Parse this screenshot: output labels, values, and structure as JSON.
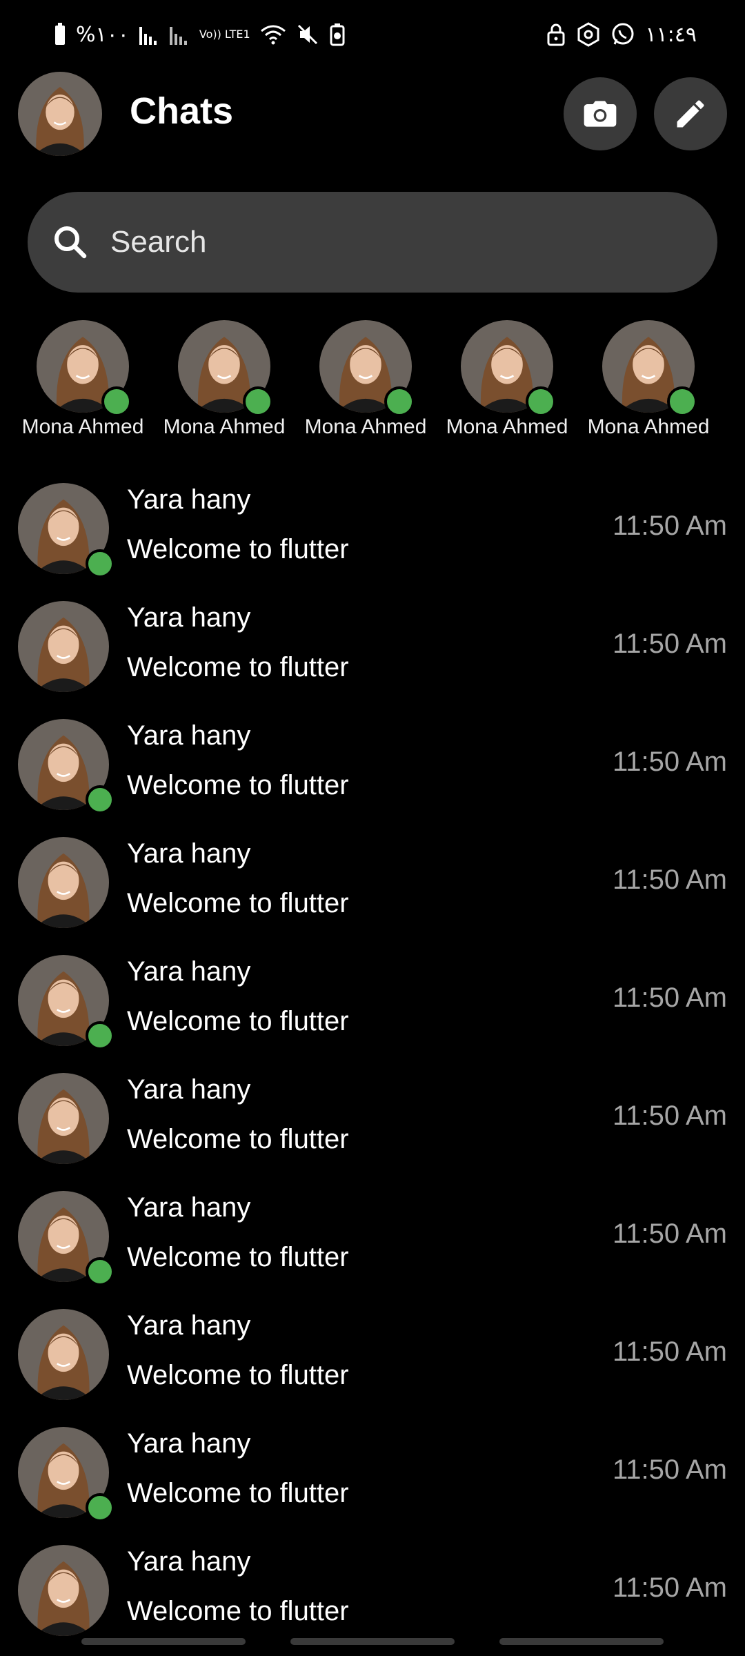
{
  "status_bar": {
    "battery_text": "%١٠٠",
    "network_label": "Vo)) LTE1",
    "time": "١١:٤٩"
  },
  "header": {
    "title": "Chats",
    "icons": [
      "camera-icon",
      "edit-icon"
    ]
  },
  "search": {
    "placeholder": "Search"
  },
  "stories": [
    {
      "name": "Mona Ahmed",
      "online": true
    },
    {
      "name": "Mona Ahmed",
      "online": true
    },
    {
      "name": "Mona Ahmed",
      "online": true
    },
    {
      "name": "Mona Ahmed",
      "online": true
    },
    {
      "name": "Mona Ahmed",
      "online": true
    }
  ],
  "chats": [
    {
      "name": "Yara hany",
      "message": "Welcome to flutter",
      "time": "11:50 Am",
      "online": true
    },
    {
      "name": "Yara hany",
      "message": "Welcome to flutter",
      "time": "11:50 Am",
      "online": false
    },
    {
      "name": "Yara hany",
      "message": "Welcome to flutter",
      "time": "11:50 Am",
      "online": true
    },
    {
      "name": "Yara hany",
      "message": "Welcome to flutter",
      "time": "11:50 Am",
      "online": false
    },
    {
      "name": "Yara hany",
      "message": "Welcome to flutter",
      "time": "11:50 Am",
      "online": true
    },
    {
      "name": "Yara hany",
      "message": "Welcome to flutter",
      "time": "11:50 Am",
      "online": false
    },
    {
      "name": "Yara hany",
      "message": "Welcome to flutter",
      "time": "11:50 Am",
      "online": true
    },
    {
      "name": "Yara hany",
      "message": "Welcome to flutter",
      "time": "11:50 Am",
      "online": false
    },
    {
      "name": "Yara hany",
      "message": "Welcome to flutter",
      "time": "11:50 Am",
      "online": true
    },
    {
      "name": "Yara hany",
      "message": "Welcome to flutter",
      "time": "11:50 Am",
      "online": false
    }
  ],
  "colors": {
    "background": "#000000",
    "online": "#4caf50",
    "search_bg": "#3d3d3d",
    "button_bg": "#3a3a3a",
    "time_text": "#a6a6a6"
  }
}
